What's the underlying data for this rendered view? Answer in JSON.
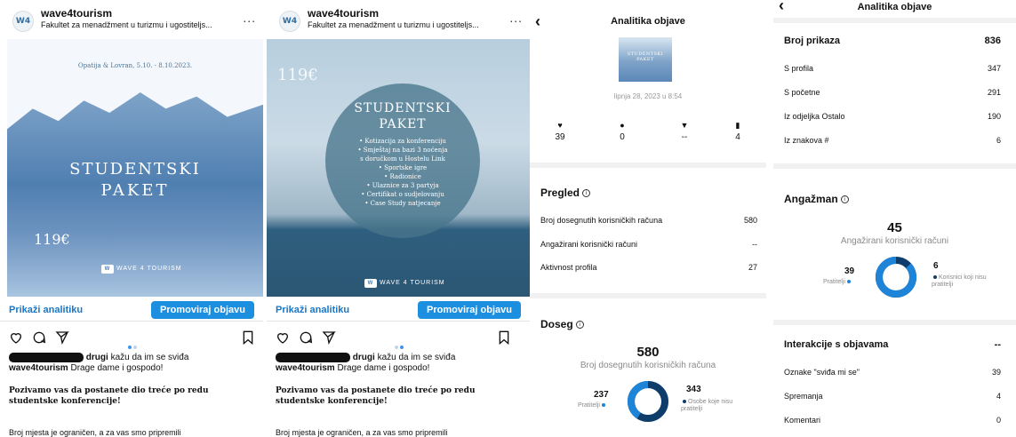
{
  "post": {
    "account": "wave4tourism",
    "subtitle": "Fakultet za menadžment u turizmu i ugostiteljs...",
    "more": "...",
    "avatar_text": "W4",
    "analytics_link": "Prikaži analitiku",
    "promote_button": "Promoviraj objavu",
    "likes_text": "drugi",
    "likes_suffix": "kažu da im se sviđa",
    "caption_user": "wave4tourism",
    "caption_start": "Drage dame i gospodo!",
    "caption_p1": "Pozivamo vas da postanete dio treće po redu studentske konferencije!",
    "caption_p2": "Broj mjesta je ograničen, a za vas smo pripremili"
  },
  "image1": {
    "date": "Opatija & Lovran, 5.10. - 8.10.2023.",
    "title_1": "STUDENTSKI",
    "title_2": "PAKET",
    "price": "119€",
    "brand": "WAVE 4 TOURISM"
  },
  "image2": {
    "price": "119€",
    "title_1": "STUDENTSKI",
    "title_2": "PAKET",
    "items": [
      "• Kotizacija za konferenciju",
      "• Smještaj na bazi 3 noćenja",
      "s doručkom u Hostelu Link",
      "• Sportske igre",
      "• Radionice",
      "• Ulaznice za 3 partyja",
      "• Certifikat o sudjelovanju",
      "• Case Study natjecanje"
    ],
    "brand": "WAVE 4 TOURISM"
  },
  "analytics1": {
    "title": "Analitika objave",
    "thumb_text": "STUDENTSKI PAKET",
    "date": "lipnja 28, 2023 u 8:54",
    "stats": [
      {
        "icon": "heart-icon",
        "value": "39"
      },
      {
        "icon": "comment-icon",
        "value": "0"
      },
      {
        "icon": "share-icon",
        "value": "--"
      },
      {
        "icon": "bookmark-icon",
        "value": "4"
      }
    ],
    "overview_title": "Pregled",
    "overview_rows": [
      {
        "label": "Broj dosegnutih korisničkih računa",
        "value": "580"
      },
      {
        "label": "Angažirani korisnički računi",
        "value": "--"
      },
      {
        "label": "Aktivnost profila",
        "value": "27"
      }
    ],
    "reach_title": "Doseg",
    "reach_total": "580",
    "reach_label": "Broj dosegnutih korisničkih računa",
    "followers_value": "237",
    "followers_label": "Pratitelji",
    "nonfollowers_value": "343",
    "nonfollowers_label": "Osobe koje nisu pratitelji",
    "followers_fraction": 0.409
  },
  "analytics2": {
    "title": "Analitika objave",
    "impressions_title": "Broj prikaza",
    "impressions_total": "836",
    "impressions_rows": [
      {
        "label": "S profila",
        "value": "347"
      },
      {
        "label": "S početne",
        "value": "291"
      },
      {
        "label": "Iz odjeljka Ostalo",
        "value": "190"
      },
      {
        "label": "Iz znakova #",
        "value": "6"
      }
    ],
    "engagement_title": "Angažman",
    "engaged_total": "45",
    "engaged_label": "Angažirani korisnički računi",
    "followers_value": "39",
    "followers_label": "Pratitelji",
    "nonfollowers_value": "6",
    "nonfollowers_label": "Korisnici koji nisu pratitelji",
    "followers_fraction": 0.867,
    "interactions_title": "Interakcije s objavama",
    "interactions_total": "--",
    "interaction_rows": [
      {
        "label": "Oznake \"sviđa mi se\"",
        "value": "39"
      },
      {
        "label": "Spremanja",
        "value": "4"
      },
      {
        "label": "Komentari",
        "value": "0"
      }
    ]
  },
  "colors": {
    "accent": "#1d8fe1",
    "followers": "#1e84d8",
    "nonfollowers": "#0e3d6b"
  }
}
